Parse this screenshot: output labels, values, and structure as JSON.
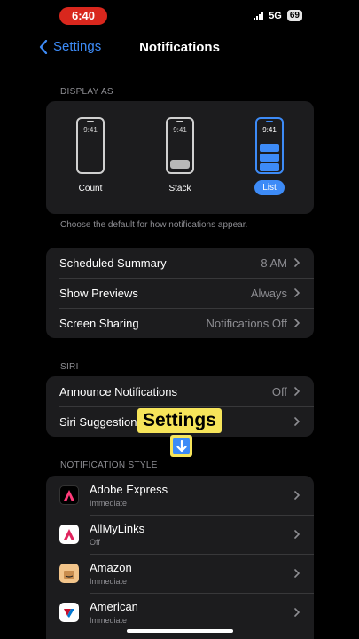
{
  "status": {
    "time": "6:40",
    "network": "5G",
    "battery": "69"
  },
  "nav": {
    "back_label": "Settings",
    "title": "Notifications"
  },
  "display_as": {
    "header": "DISPLAY AS",
    "phone_clock": "9:41",
    "options": [
      {
        "label": "Count",
        "selected": false
      },
      {
        "label": "Stack",
        "selected": false
      },
      {
        "label": "List",
        "selected": true
      }
    ],
    "footnote": "Choose the default for how notifications appear."
  },
  "general_rows": [
    {
      "label": "Scheduled Summary",
      "value": "8 AM"
    },
    {
      "label": "Show Previews",
      "value": "Always"
    },
    {
      "label": "Screen Sharing",
      "value": "Notifications Off"
    }
  ],
  "siri": {
    "header": "SIRI",
    "rows": [
      {
        "label": "Announce Notifications",
        "value": "Off"
      },
      {
        "label": "Siri Suggestions",
        "value": ""
      }
    ]
  },
  "notification_style": {
    "header": "NOTIFICATION STYLE",
    "apps": [
      {
        "name": "Adobe Express",
        "detail": "Immediate",
        "icon": "adobe-express-icon",
        "color": "#000000"
      },
      {
        "name": "AllMyLinks",
        "detail": "Off",
        "icon": "allmylinks-icon",
        "color": "#ffffff"
      },
      {
        "name": "Amazon",
        "detail": "Immediate",
        "icon": "amazon-icon",
        "color": "#f2c48a"
      },
      {
        "name": "American",
        "detail": "Immediate",
        "icon": "american-airlines-icon",
        "color": "#ffffff"
      }
    ]
  },
  "overlay": {
    "caption": "Settings",
    "arrow": "down-arrow-icon"
  },
  "colors": {
    "accent": "#3d8bf7",
    "card": "#1c1c1e",
    "caption_bg": "#f6e45a",
    "recording": "#d9271d"
  }
}
